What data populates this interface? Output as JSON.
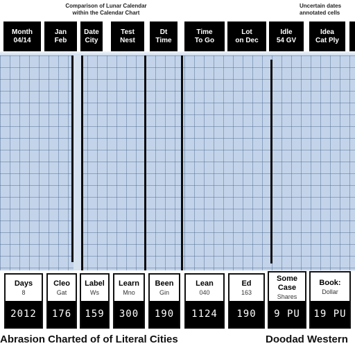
{
  "header": {
    "title_lines": [
      "Comparison of Lunar Calendar",
      "within the Calendar Chart"
    ],
    "right_title_lines": [
      "Uncertain dates",
      "annotated cells"
    ]
  },
  "columns": [
    {
      "top": [
        "Month",
        "04/14"
      ],
      "bottom": [
        "Days",
        "8"
      ],
      "value": "2012"
    },
    {
      "top": [
        "Jan",
        "Feb"
      ],
      "bottom": [
        "Cleo",
        "Gat"
      ],
      "value": "176"
    },
    {
      "top": [
        "Date",
        "City"
      ],
      "bottom": [
        "Label",
        "Ws"
      ],
      "value": "159"
    },
    {
      "top": [
        "Test",
        "Nest"
      ],
      "bottom": [
        "Learn",
        "Mno"
      ],
      "value": "300"
    },
    {
      "top": [
        "Dt",
        "Time"
      ],
      "bottom": [
        "Been",
        "Gin"
      ],
      "value": "190"
    },
    {
      "top": [
        "Time",
        "To Go"
      ],
      "bottom": [
        "Lean",
        "040"
      ],
      "value": "1124"
    },
    {
      "top": [
        "Lot",
        "on Dec"
      ],
      "bottom": [
        "Ed",
        "163"
      ],
      "value": "190"
    },
    {
      "top": [
        "Idle",
        "54 GV"
      ],
      "bottom": [
        "Some Case",
        "Shares"
      ],
      "value": "9 PU"
    },
    {
      "top": [
        "Idea",
        "Cat Ply"
      ],
      "bottom": [
        "Book:",
        "Dollar"
      ],
      "value": "19 PU"
    }
  ],
  "footer": {
    "left_caption": "Abrasion Charted of of Literal Cities",
    "right_caption": "Doodad Western"
  },
  "colors": {
    "grid_fill": "#c3d4ea",
    "grid_line": "#46648c",
    "cell_dark": "#000000",
    "cell_light": "#ffffff"
  }
}
